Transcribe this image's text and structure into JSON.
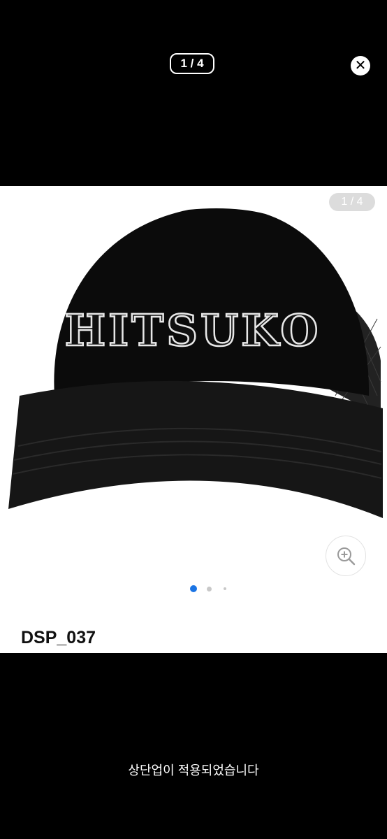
{
  "viewer": {
    "counter": "1 / 4",
    "close_icon": "close-icon"
  },
  "gallery": {
    "image_counter": "1 / 4",
    "image_text": "HITSUKO",
    "active_index": 1,
    "total_dots": 3
  },
  "product": {
    "title": "DSP_037"
  },
  "toast": {
    "message": "상단업이 적용되었습니다"
  }
}
